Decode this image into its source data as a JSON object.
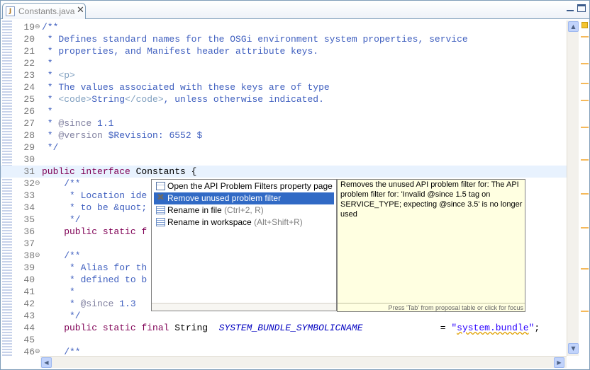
{
  "tab": {
    "label": "Constants.java",
    "close": "✕",
    "icon": "java-file-icon"
  },
  "lines": [
    {
      "num": "19",
      "fold": "⊖",
      "html": "<span class='c'>/**</span>"
    },
    {
      "num": "20",
      "fold": "",
      "html": "<span class='c'> * Defines standard names for the OSGi environment system properties, service</span>"
    },
    {
      "num": "21",
      "fold": "",
      "html": "<span class='c'> * properties, and Manifest header attribute keys.</span>"
    },
    {
      "num": "22",
      "fold": "",
      "html": "<span class='c'> *</span>"
    },
    {
      "num": "23",
      "fold": "",
      "html": "<span class='c'> * </span><span class='tag'>&lt;p&gt;</span>"
    },
    {
      "num": "24",
      "fold": "",
      "html": "<span class='c'> * The values associated with these keys are of type</span>"
    },
    {
      "num": "25",
      "fold": "",
      "html": "<span class='c'> * </span><span class='tag'>&lt;code&gt;</span><span class='c'>String</span><span class='tag'>&lt;/code&gt;</span><span class='c'>, unless otherwise indicated.</span>"
    },
    {
      "num": "26",
      "fold": "",
      "html": "<span class='c'> *</span>"
    },
    {
      "num": "27",
      "fold": "",
      "html": "<span class='c'> * </span><span class='t'>@since</span><span class='c'> 1.1</span>"
    },
    {
      "num": "28",
      "fold": "",
      "html": "<span class='c'> * </span><span class='t'>@version</span><span class='c'> $Revision: 6552 $</span>"
    },
    {
      "num": "29",
      "fold": "",
      "html": "<span class='c'> */</span>"
    },
    {
      "num": "30",
      "fold": "",
      "html": ""
    },
    {
      "num": "31",
      "fold": "",
      "html": "<span class='k'>public interface</span><span class='n'> Constants {</span>",
      "cur": true
    },
    {
      "num": "32",
      "fold": "⊖",
      "html": "<span class='c'>    /**</span>"
    },
    {
      "num": "33",
      "fold": "",
      "html": "<span class='c'>     * Location ide</span>"
    },
    {
      "num": "34",
      "fold": "",
      "html": "<span class='c'>     * to be &amp;quot;</span>"
    },
    {
      "num": "35",
      "fold": "",
      "html": "<span class='c'>     */</span>"
    },
    {
      "num": "36",
      "fold": "",
      "html": "<span class='k'>    public static f</span>                                                              <span class='s'><span class='sq'>ndle</span>\"</span><span class='n'>;</span>"
    },
    {
      "num": "37",
      "fold": "",
      "html": ""
    },
    {
      "num": "38",
      "fold": "⊖",
      "html": "<span class='c'>    /**</span>"
    },
    {
      "num": "39",
      "fold": "",
      "html": "<span class='c'>     * Alias for th</span>"
    },
    {
      "num": "40",
      "fold": "",
      "html": "<span class='c'>     * defined to b</span>"
    },
    {
      "num": "41",
      "fold": "",
      "html": "<span class='c'>     *</span>"
    },
    {
      "num": "42",
      "fold": "",
      "html": "<span class='c'>     * </span><span class='t'>@since</span><span class='c'> 1.3</span>"
    },
    {
      "num": "43",
      "fold": "",
      "html": "<span class='c'>     */</span>"
    },
    {
      "num": "44",
      "fold": "",
      "html": "<span class='k'>    public static final</span><span class='n'> String  </span><span class='f'>SYSTEM_BUNDLE_SYMBOLICNAME</span><span class='n'>              = </span><span class='s'>\"<span class='sq'>system.bundle</span>\"</span><span class='n'>;</span>"
    },
    {
      "num": "45",
      "fold": "",
      "html": ""
    },
    {
      "num": "46",
      "fold": "⊖",
      "html": "<span class='c'>    /**</span>"
    }
  ],
  "proposals": [
    {
      "icon": "property-page-icon",
      "label": "Open the API Problem Filters property page",
      "shortcut": "",
      "selected": false
    },
    {
      "icon": "remove-icon",
      "label": "Remove unused problem filter",
      "shortcut": "",
      "selected": true
    },
    {
      "icon": "rename-icon",
      "label": "Rename in file",
      "shortcut": "(Ctrl+2, R)",
      "selected": false
    },
    {
      "icon": "rename-icon",
      "label": "Rename in workspace",
      "shortcut": "(Alt+Shift+R)",
      "selected": false
    }
  ],
  "tooltip": {
    "text": "Removes the unused API problem filter for: The API problem filter for: 'Invalid @since 1.5 tag on SERVICE_TYPE; expecting @since 3.5' is no longer used",
    "footer": "Press 'Tab' from proposal table or click for focus"
  },
  "colors": {
    "selection": "#316ac5",
    "tooltip_bg": "#ffffe1",
    "comment": "#3f5fbf",
    "keyword": "#7f0055",
    "string": "#2a00ff"
  }
}
